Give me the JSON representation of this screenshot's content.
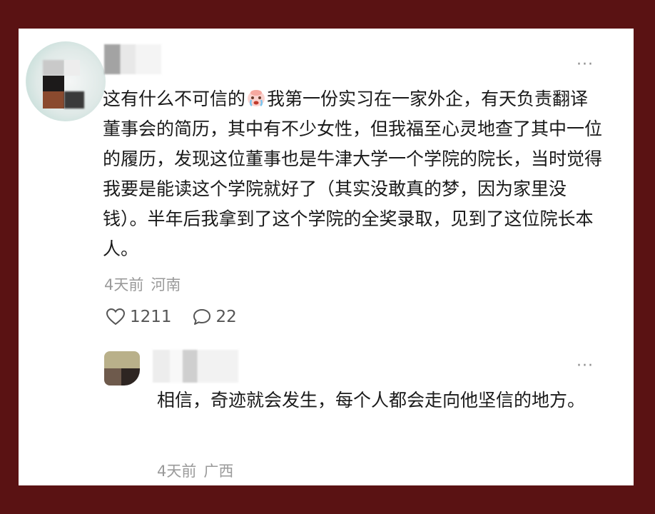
{
  "comment": {
    "text": "这有什么不可信的🥹我第一份实习在一家外企，有天负责翻译董事会的简历，其中有不少女性，但我福至心灵地查了其中一位的履历，发现这位董事也是牛津大学一个学院的院长，当时觉得我要是能读这个学院就好了（其实没敢真的梦，因为家里没钱）。半年后我拿到了这个学院的全奖录取，见到了这位院长本人。",
    "text_before_emoji": "这有什么不可信的",
    "text_after_emoji": "我第一份实习在一家外企，有天负责翻译董事会的简历，其中有不少女性，但我福至心灵地查了其中一位的履历，发现这位董事也是牛津大学一个学院的院长，当时觉得我要是能读这个学院就好了（其实没敢真的梦，因为家里没钱）。半年后我拿到了这个学院的全奖录取，见到了这位院长本人。",
    "emoji": "crying-face-emoji",
    "time": "4天前",
    "location": "河南",
    "likes": "1211",
    "replies_count": "22",
    "more": "···"
  },
  "reply": {
    "text": "相信，奇迹就会发生，每个人都会走向他坚信的地方。",
    "time": "4天前",
    "location": "广西",
    "more": "···"
  },
  "icons": {
    "like": "heart-outline-icon",
    "reply": "speech-bubble-icon",
    "more": "more-dots-icon"
  },
  "colors": {
    "frame": "#5a1213",
    "text": "#1a1a1a",
    "meta": "#9a9a9a"
  }
}
